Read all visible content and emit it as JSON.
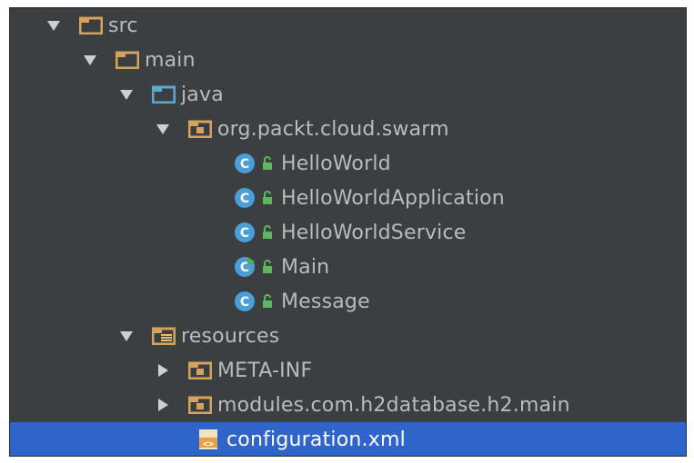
{
  "tree": {
    "items": [
      {
        "label": "src",
        "kind": "folder",
        "expanded": true,
        "depth": 0
      },
      {
        "label": "main",
        "kind": "folder",
        "expanded": true,
        "depth": 1
      },
      {
        "label": "java",
        "kind": "source-folder",
        "expanded": true,
        "depth": 2
      },
      {
        "label": "org.packt.cloud.swarm",
        "kind": "package",
        "expanded": true,
        "depth": 3
      },
      {
        "label": "HelloWorld",
        "kind": "class",
        "depth": 4
      },
      {
        "label": "HelloWorldApplication",
        "kind": "class",
        "depth": 4
      },
      {
        "label": "HelloWorldService",
        "kind": "class",
        "depth": 4
      },
      {
        "label": "Main",
        "kind": "class-runnable",
        "depth": 4
      },
      {
        "label": "Message",
        "kind": "class",
        "depth": 4
      },
      {
        "label": "resources",
        "kind": "resources-folder",
        "expanded": true,
        "depth": 2
      },
      {
        "label": "META-INF",
        "kind": "package",
        "expanded": false,
        "depth": 3
      },
      {
        "label": "modules.com.h2database.h2.main",
        "kind": "package",
        "expanded": false,
        "depth": 3
      },
      {
        "label": "configuration.xml",
        "kind": "xml-file",
        "selected": true,
        "depth": 3
      }
    ]
  },
  "colors": {
    "background": "#3c3f41",
    "selection": "#2f65ca",
    "text": "#bbbbbb",
    "folder": "#d7a35a",
    "source_folder": "#5fa7d5",
    "class_icon": "#4a9fd8",
    "lock": "#5cb85c"
  }
}
